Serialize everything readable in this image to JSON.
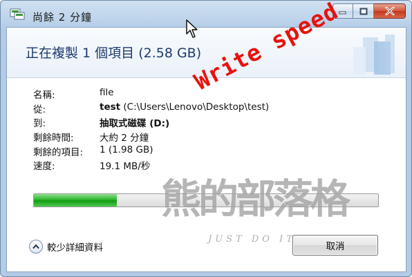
{
  "window": {
    "title": "尚餘 2 分鐘",
    "controls": {
      "minimize_icon": "minimize-icon",
      "maximize_icon": "maximize-icon",
      "close_icon": "close-icon"
    }
  },
  "dialog": {
    "heading": "正在複製 1 個項目 (2.58 GB)",
    "details": {
      "name_label": "名稱:",
      "name_value": "file",
      "from_label": "從:",
      "from_name": "test",
      "from_path": "(C:\\Users\\Lenovo\\Desktop\\test)",
      "to_label": "到:",
      "to_value": "抽取式磁碟 (D:)",
      "time_left_label": "剩餘時間:",
      "time_left_value": "大約 2 分鐘",
      "items_left_label": "剩餘的項目:",
      "items_left_value": "1 (1.98 GB)",
      "speed_label": "速度:",
      "speed_value": "19.1 MB/秒"
    },
    "progress": {
      "fraction": 0.24,
      "color": "#22b022"
    },
    "footer": {
      "less_details_label": "較少詳細資料",
      "cancel_label": "取消"
    }
  },
  "overlay": {
    "annotation_text": "Write speed",
    "annotation_color": "#e8120c",
    "watermark_text": "熊的部落格",
    "watermark_sub": "JUST DO IT"
  }
}
